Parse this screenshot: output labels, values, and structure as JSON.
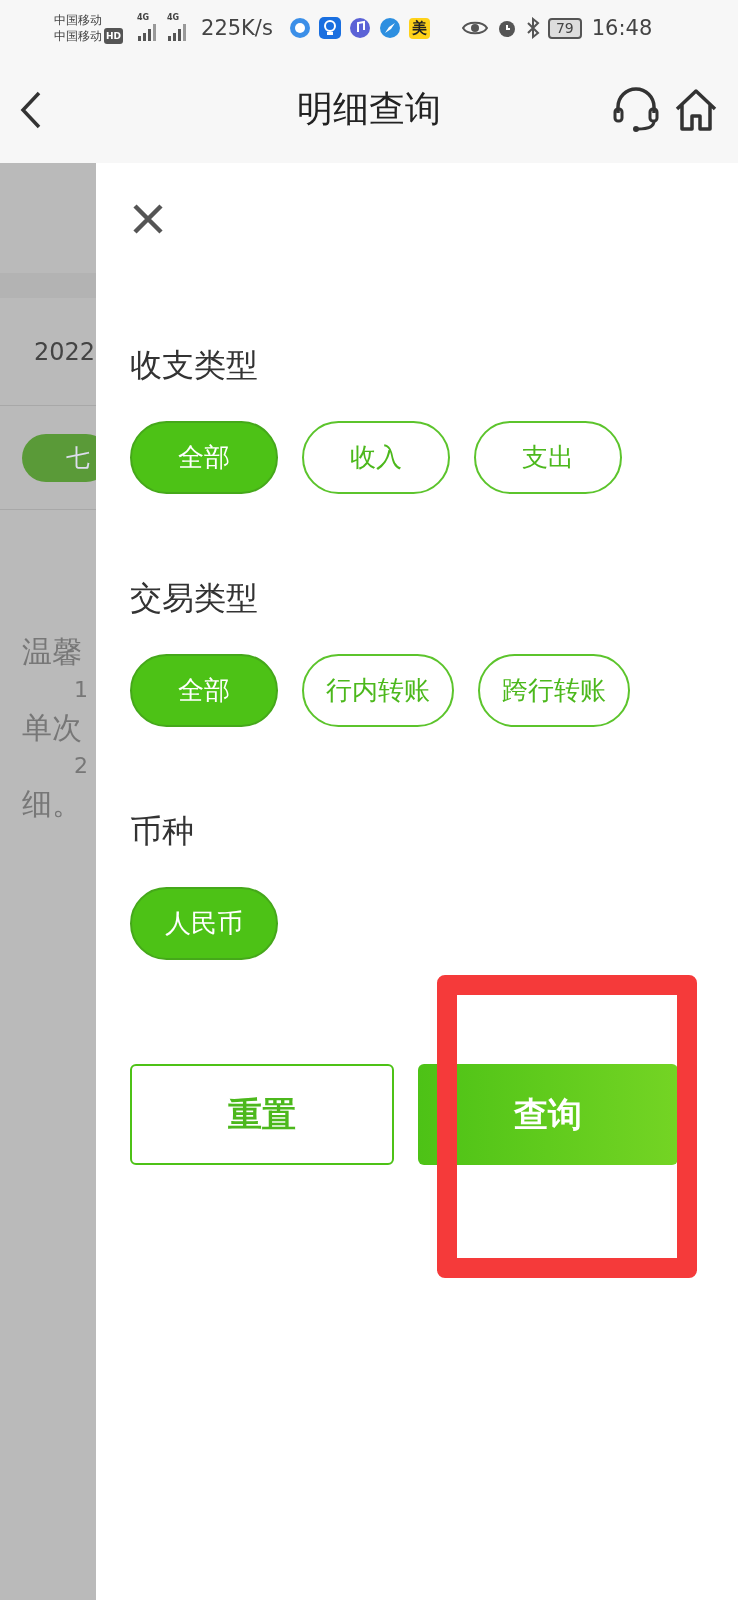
{
  "status_bar": {
    "carriers": [
      "中国移动",
      "中国移动"
    ],
    "hd_badge": "HD",
    "network_labels": [
      "4G",
      "4G"
    ],
    "speed": "225K/s",
    "app_badge": "美",
    "battery": "79",
    "time": "16:48"
  },
  "header": {
    "title": "明细查询"
  },
  "background_page": {
    "date": "2022",
    "period_chip": {
      "label": "七",
      "selected": true
    },
    "notice_lines": [
      "温馨",
      "1",
      "单次",
      "2",
      "细。"
    ]
  },
  "drawer": {
    "sections": [
      {
        "title": "收支类型",
        "options": [
          {
            "label": "全部",
            "selected": true
          },
          {
            "label": "收入",
            "selected": false
          },
          {
            "label": "支出",
            "selected": false
          }
        ]
      },
      {
        "title": "交易类型",
        "options": [
          {
            "label": "全部",
            "selected": true
          },
          {
            "label": "行内转账",
            "selected": false
          },
          {
            "label": "跨行转账",
            "selected": false
          }
        ]
      },
      {
        "title": "币种",
        "options": [
          {
            "label": "人民币",
            "selected": true
          }
        ]
      }
    ],
    "buttons": [
      {
        "label": "重置",
        "kind": "reset"
      },
      {
        "label": "查询",
        "kind": "query"
      }
    ]
  }
}
